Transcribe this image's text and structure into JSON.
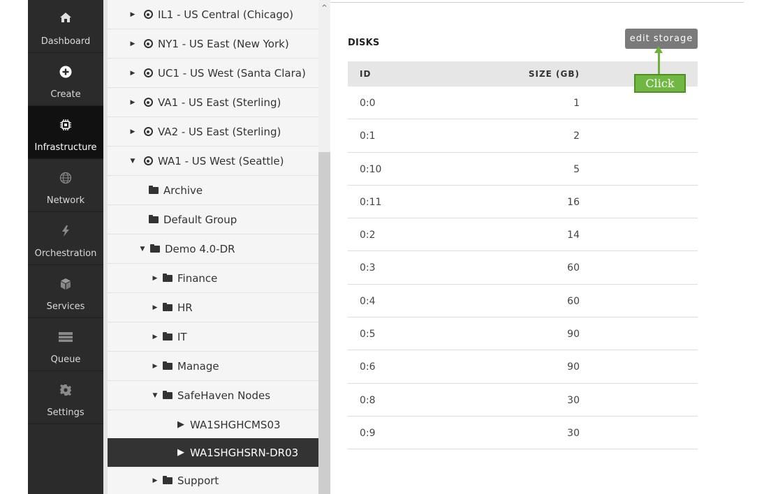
{
  "nav": {
    "items": [
      {
        "label": "Dashboard",
        "icon": "home-icon"
      },
      {
        "label": "Create",
        "icon": "plus-circle-icon"
      },
      {
        "label": "Infrastructure",
        "icon": "chip-icon"
      },
      {
        "label": "Network",
        "icon": "globe-icon"
      },
      {
        "label": "Orchestration",
        "icon": "orchestration-icon"
      },
      {
        "label": "Services",
        "icon": "cube-icon"
      },
      {
        "label": "Queue",
        "icon": "queue-icon"
      },
      {
        "label": "Settings",
        "icon": "gear-icon"
      }
    ],
    "active": "Infrastructure"
  },
  "tree": {
    "rows": [
      {
        "label": "IL1 - US Central (Chicago)"
      },
      {
        "label": "NY1 - US East (New York)"
      },
      {
        "label": "UC1 - US West (Santa Clara)"
      },
      {
        "label": "VA1 - US East (Sterling)"
      },
      {
        "label": "VA2 - US East (Sterling)"
      },
      {
        "label": "WA1 - US West (Seattle)"
      },
      {
        "label": "Archive"
      },
      {
        "label": "Default Group"
      },
      {
        "label": "Demo 4.0-DR"
      },
      {
        "label": "Finance"
      },
      {
        "label": "HR"
      },
      {
        "label": "IT"
      },
      {
        "label": "Manage"
      },
      {
        "label": "SafeHaven Nodes"
      },
      {
        "label": "WA1SHGHCMS03"
      },
      {
        "label": "WA1SHGHSRN-DR03"
      },
      {
        "label": "Support"
      }
    ],
    "selected": "WA1SHGHSRN-DR03"
  },
  "disks": {
    "title": "DISKS",
    "edit_button": "edit storage",
    "columns": {
      "id": "ID",
      "size": "SIZE (GB)"
    },
    "rows": [
      {
        "id": "0:0",
        "size": "1"
      },
      {
        "id": "0:1",
        "size": "2"
      },
      {
        "id": "0:10",
        "size": "5"
      },
      {
        "id": "0:11",
        "size": "16"
      },
      {
        "id": "0:2",
        "size": "14"
      },
      {
        "id": "0:3",
        "size": "60"
      },
      {
        "id": "0:4",
        "size": "60"
      },
      {
        "id": "0:5",
        "size": "90"
      },
      {
        "id": "0:6",
        "size": "90"
      },
      {
        "id": "0:8",
        "size": "30"
      },
      {
        "id": "0:9",
        "size": "30"
      }
    ]
  },
  "annotation": {
    "label": "Click",
    "color": "#71b743"
  },
  "colors": {
    "nav_bg": "#2b2b2b",
    "nav_active": "#111111",
    "tree_selected": "#333333",
    "button_bg": "#7a7a7a"
  }
}
